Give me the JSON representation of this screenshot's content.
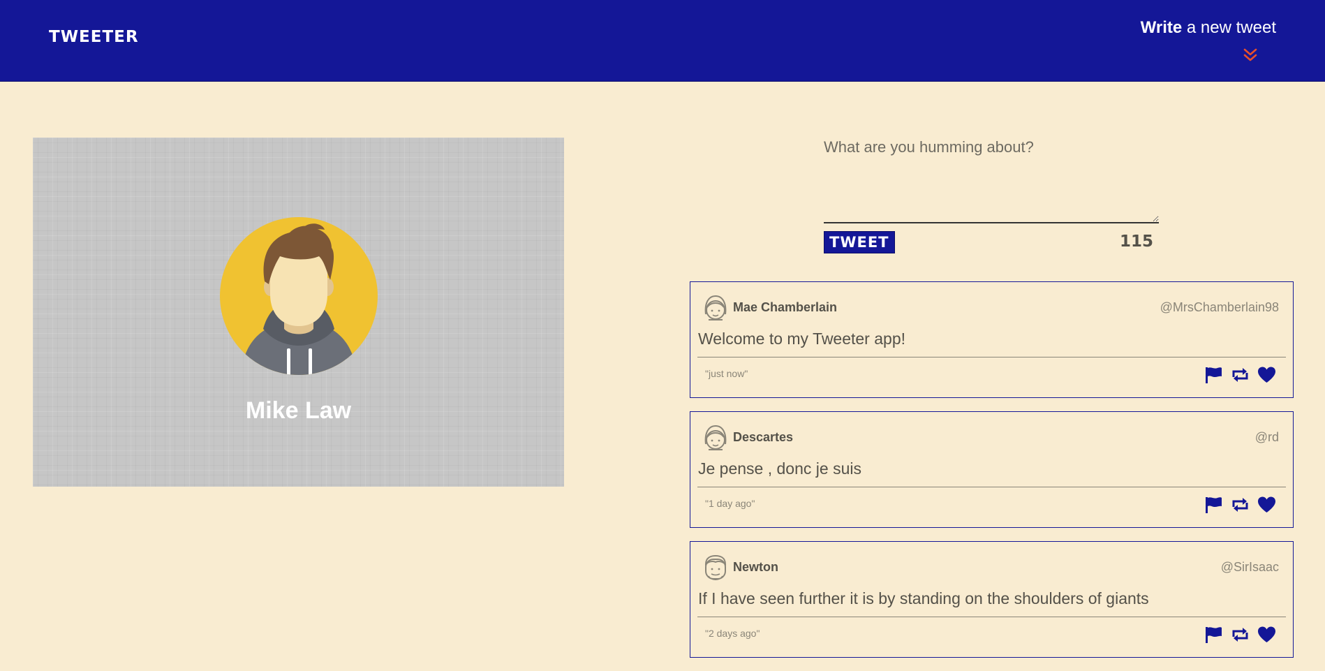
{
  "nav": {
    "brand": "TWEETER",
    "compose_bold": "Write",
    "compose_rest": " a new tweet",
    "compose_icon": "chevron-double-down-icon",
    "accent_color": "#e8502a"
  },
  "profile": {
    "name": "Mike Law",
    "avatar_icon": "user-avatar"
  },
  "composer": {
    "placeholder": "What are you humming about?",
    "button_label": "TWEET",
    "char_count": "115"
  },
  "colors": {
    "primary": "#141797",
    "background": "#f9ecd1",
    "text": "#545149"
  },
  "tweets": [
    {
      "name": "Mae Chamberlain",
      "handle": "@MrsChamberlain98",
      "content": "Welcome to my Tweeter app!",
      "time": "\"just now\"",
      "avatar": "girl-face-icon"
    },
    {
      "name": "Descartes",
      "handle": "@rd",
      "content": "Je pense , donc je suis",
      "time": "\"1 day ago\"",
      "avatar": "girl-face-icon"
    },
    {
      "name": "Newton",
      "handle": "@SirIsaac",
      "content": "If I have seen further it is by standing on the shoulders of giants",
      "time": "\"2 days ago\"",
      "avatar": "man-face-icon"
    }
  ]
}
